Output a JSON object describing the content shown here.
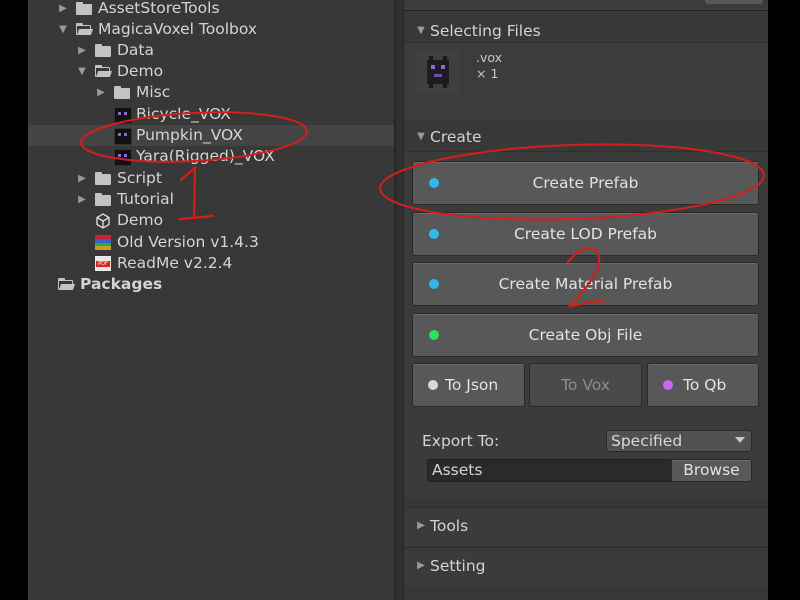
{
  "project_tree": {
    "items": [
      {
        "label": "AssetStoreTools",
        "icon": "folder-icon"
      },
      {
        "label": "MagicaVoxel Toolbox",
        "icon": "folder-open-icon"
      },
      {
        "label": "Data",
        "icon": "folder-icon"
      },
      {
        "label": "Demo",
        "icon": "folder-open-icon"
      },
      {
        "label": "Misc",
        "icon": "folder-icon"
      },
      {
        "label": "Bicycle_VOX",
        "icon": "vox-file-icon"
      },
      {
        "label": "Pumpkin_VOX",
        "icon": "vox-file-icon"
      },
      {
        "label": "Yara(Rigged)_VOX",
        "icon": "vox-file-icon"
      },
      {
        "label": "Script",
        "icon": "folder-icon"
      },
      {
        "label": "Tutorial",
        "icon": "folder-icon"
      },
      {
        "label": "Demo",
        "icon": "unity-scene-icon"
      },
      {
        "label": "Old Version v1.4.3",
        "icon": "rar-archive-icon"
      },
      {
        "label": "ReadMe v2.2.4",
        "icon": "pdf-icon"
      },
      {
        "label": "Packages",
        "icon": "folder-open-icon"
      }
    ],
    "pdf_tag": "PDF"
  },
  "inspector": {
    "selecting_files": {
      "title": "Selecting Files",
      "extension": ".vox",
      "count": "× 1"
    },
    "create": {
      "title": "Create",
      "create_prefab": "Create Prefab",
      "create_lod_prefab": "Create LOD Prefab",
      "create_material_prefab": "Create Material Prefab",
      "create_obj_file": "Create Obj File",
      "to_json": "To Json",
      "to_vox": "To Vox",
      "to_qb": "To Qb",
      "export_to_label": "Export To:",
      "export_mode": "Specified",
      "export_path": "Assets",
      "browse": "Browse"
    },
    "tools": {
      "title": "Tools"
    },
    "setting": {
      "title": "Setting"
    }
  },
  "colors": {
    "dot_blue": "#2fb8f0",
    "dot_green": "#2fe05a",
    "dot_white": "#d8d8d8",
    "dot_purple": "#c86af0",
    "annotation_red": "#d41e1e"
  },
  "annotations": {
    "mark_1": "1",
    "mark_2": "2"
  }
}
